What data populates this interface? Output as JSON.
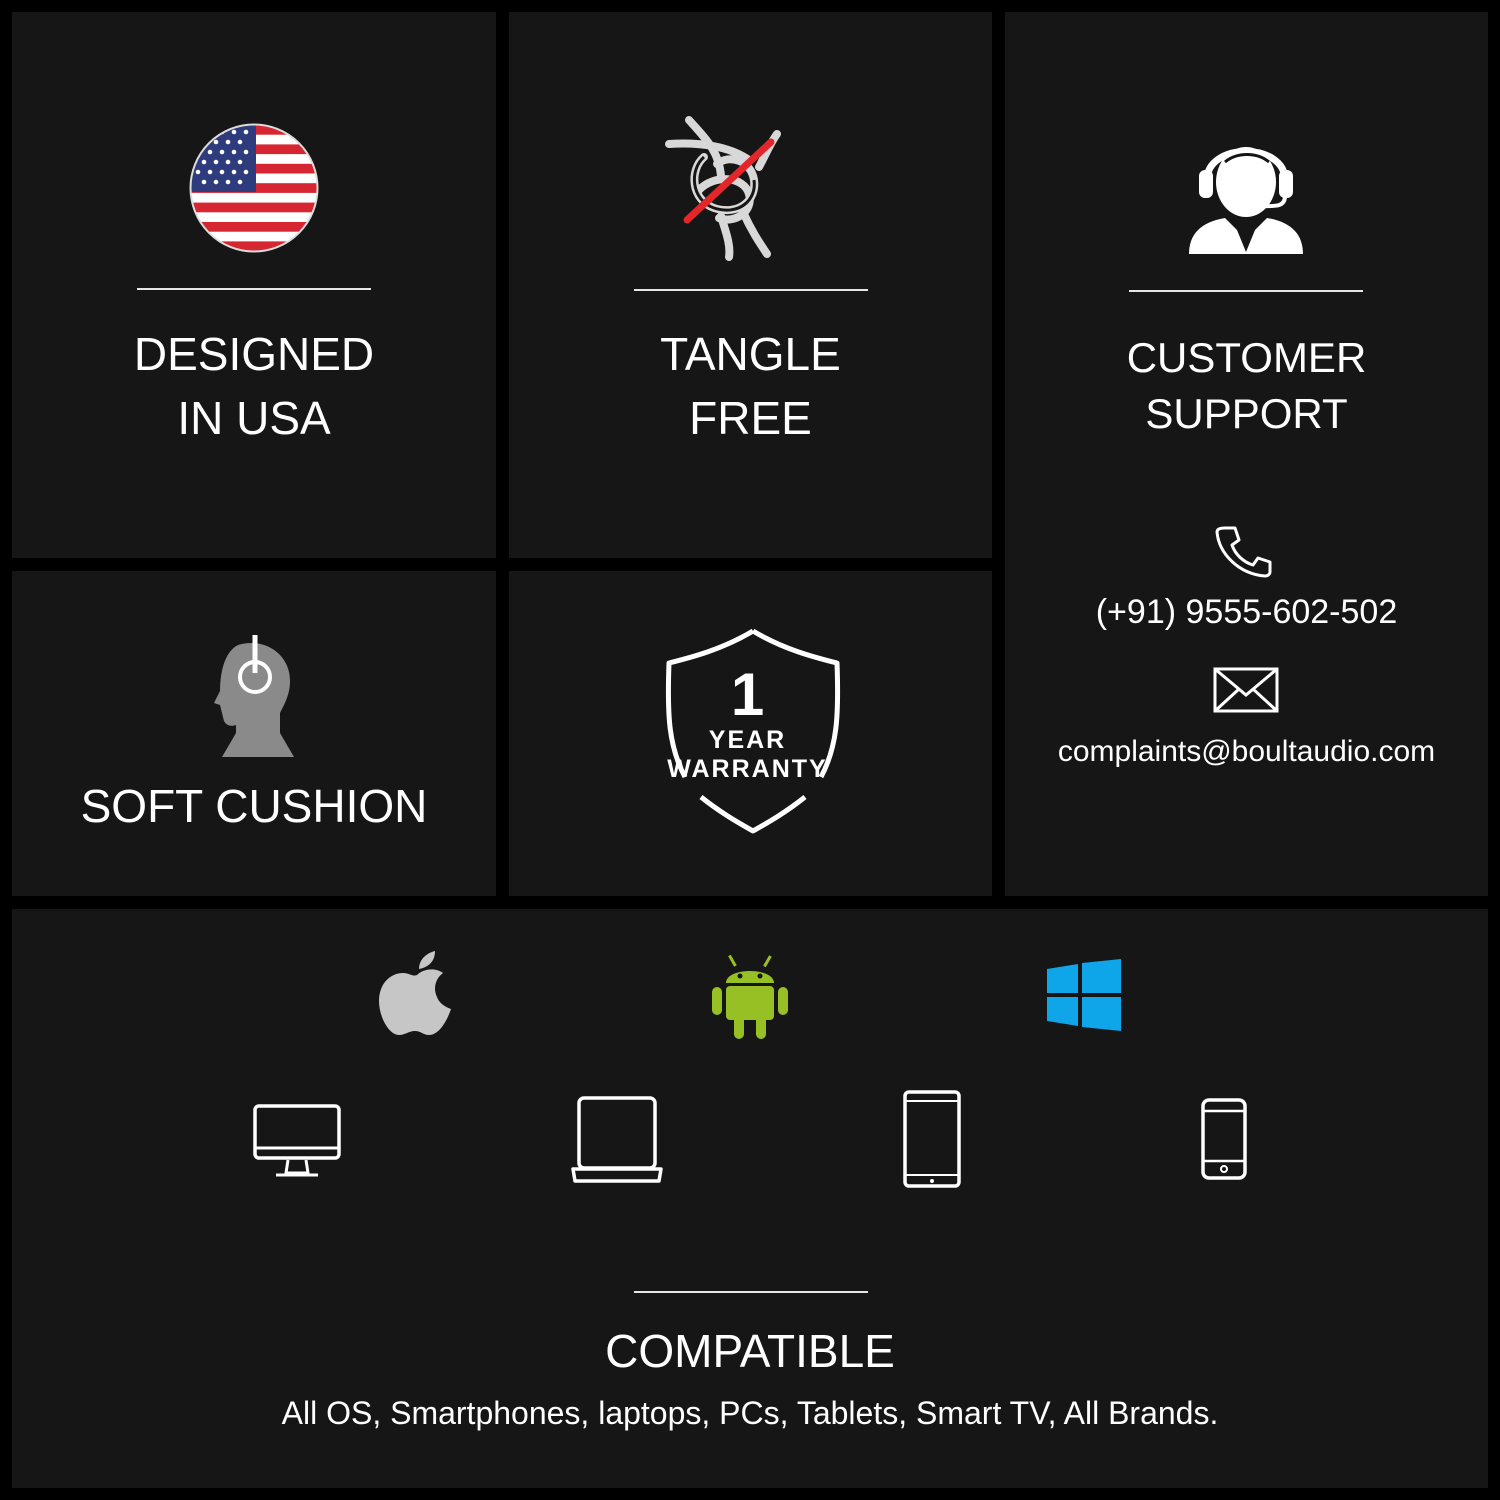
{
  "designed": {
    "line1": "DESIGNED",
    "line2": "IN USA",
    "icon": "us-flag-icon"
  },
  "tangle": {
    "line1": "TANGLE",
    "line2": "FREE",
    "icon": "knotted-cable-crossed-icon"
  },
  "support": {
    "line1": "CUSTOMER",
    "line2": "SUPPORT",
    "icon": "customer-support-agent-icon",
    "phone": "(+91) 9555-602-502",
    "email": "complaints@boultaudio.com"
  },
  "cushion": {
    "label": "SOFT CUSHION",
    "icon": "head-with-headphones-icon"
  },
  "warranty": {
    "number": "1",
    "line1": "YEAR",
    "line2": "WARRANTY",
    "icon": "shield-icon"
  },
  "compatible": {
    "title": "COMPATIBLE",
    "subtitle": "All OS, Smartphones, laptops, PCs, Tablets, Smart TV, All Brands.",
    "os_icons": [
      "apple-icon",
      "android-icon",
      "windows-icon"
    ],
    "device_icons": [
      "monitor-icon",
      "laptop-icon",
      "tablet-icon",
      "smartphone-icon"
    ]
  },
  "colors": {
    "background": "#000000",
    "panel": "#161616",
    "text": "#ffffff",
    "android": "#97c024",
    "windows": "#0ea5e9",
    "apple": "#c6c6c6",
    "slash": "#e2262a"
  }
}
